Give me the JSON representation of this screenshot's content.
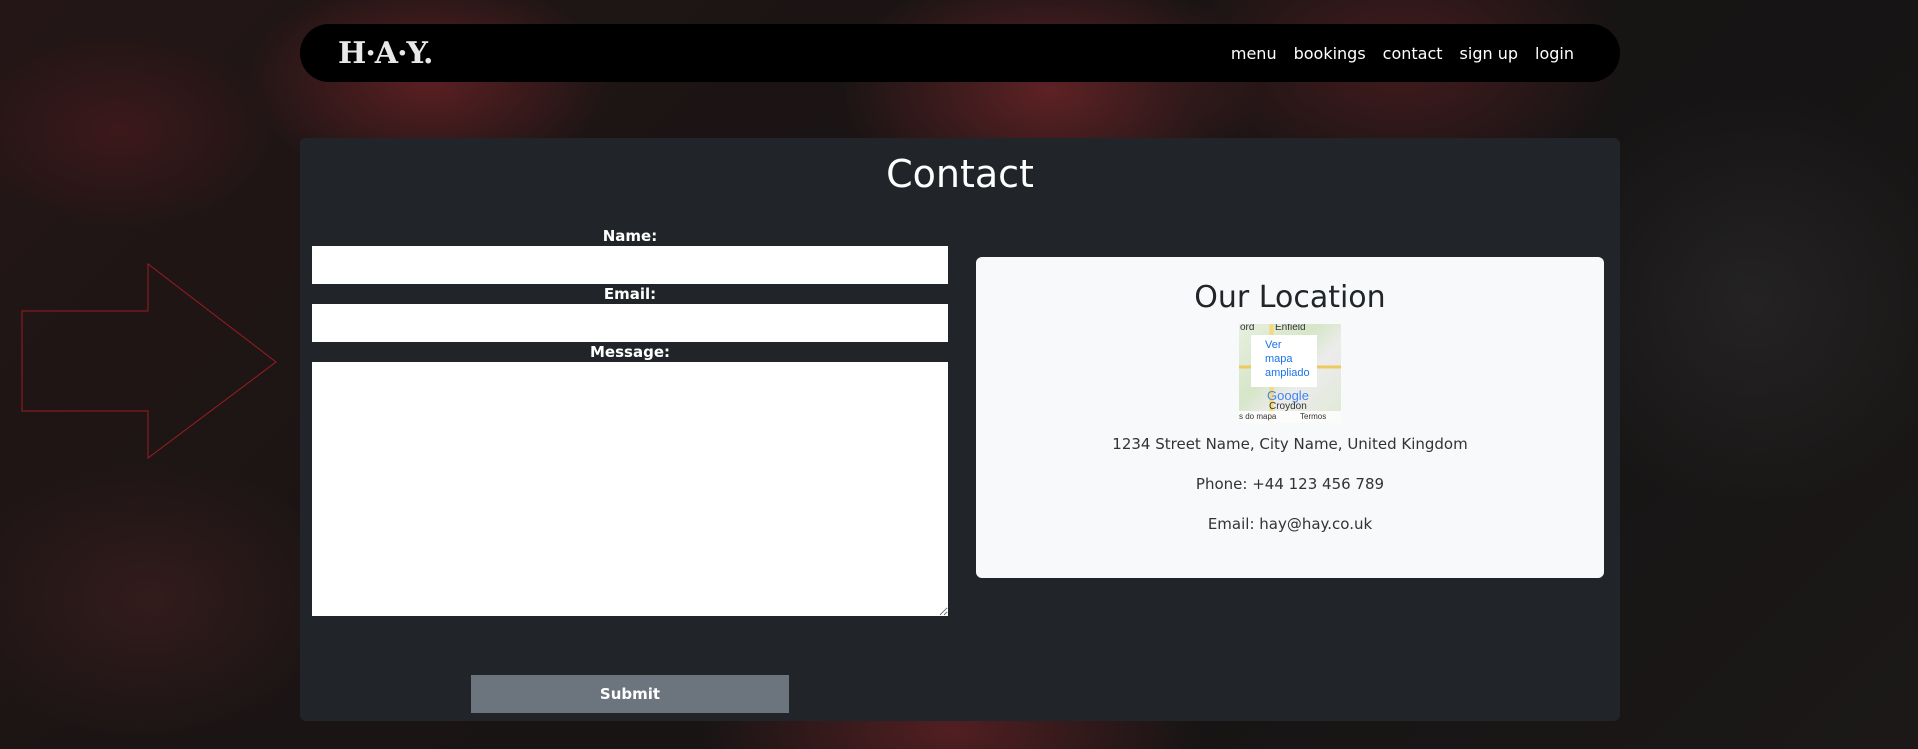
{
  "nav": {
    "logo": "H·A·Y.",
    "links": [
      "menu",
      "bookings",
      "contact",
      "sign up",
      "login"
    ]
  },
  "contact": {
    "title": "Contact",
    "form": {
      "name_label": "Name:",
      "email_label": "Email:",
      "message_label": "Message:",
      "name_value": "",
      "email_value": "",
      "message_value": "",
      "submit_label": "Submit"
    },
    "location": {
      "title": "Our Location",
      "map": {
        "top_left": "ord",
        "top_place": "Enfield",
        "link": "Ver\nmapa\nampliado",
        "logo": "Google",
        "place": "Croydon",
        "footer_left": "s do mapa",
        "footer_right": "Termos"
      },
      "address": "1234 Street Name, City Name, United Kingdom",
      "phone": "Phone: +44 123 456 789",
      "email": "Email: hay@hay.co.uk"
    }
  },
  "colors": {
    "navbar": "#000000",
    "card": "#212529",
    "panel": "#f8f9fa",
    "submit": "#6c757d",
    "arrow_outline": "#9b1c22"
  }
}
